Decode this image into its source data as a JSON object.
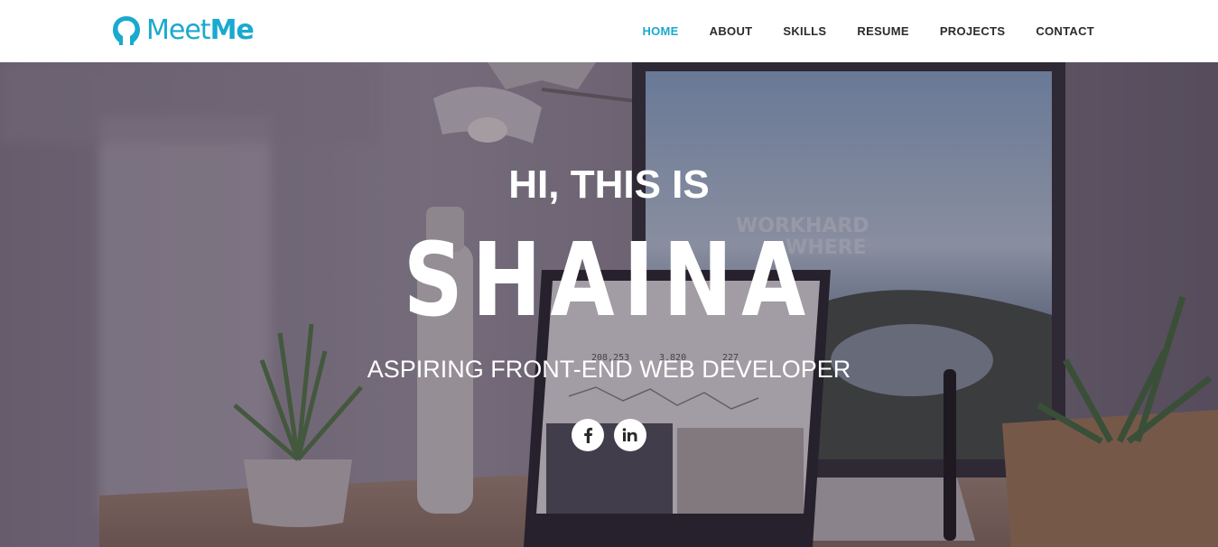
{
  "brand": {
    "name_light": "Meet",
    "name_bold": "Me",
    "icon": "user-head-icon",
    "color": "#1aa9cf"
  },
  "nav": {
    "items": [
      {
        "label": "HOME",
        "active": true
      },
      {
        "label": "ABOUT",
        "active": false
      },
      {
        "label": "SKILLS",
        "active": false
      },
      {
        "label": "RESUME",
        "active": false
      },
      {
        "label": "PROJECTS",
        "active": false
      },
      {
        "label": "CONTACT",
        "active": false
      }
    ],
    "active_color": "#1aa9cf",
    "text_color": "#2b2b2b"
  },
  "hero": {
    "greeting": "HI, THIS IS",
    "name": "SHAINA",
    "subtitle": "ASPIRING FRONT-END WEB DEVELOPER",
    "background": {
      "screen_text_line1": "WORKHARD",
      "screen_text_line2": "WHERE",
      "laptop_stats": [
        "208,253",
        "3,820",
        "227"
      ]
    }
  },
  "social": [
    {
      "icon": "facebook-icon"
    },
    {
      "icon": "linkedin-icon"
    }
  ]
}
